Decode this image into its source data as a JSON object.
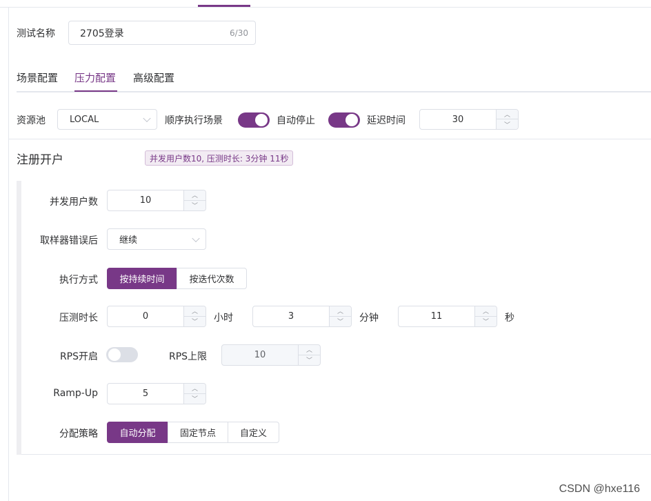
{
  "test": {
    "name_label": "测试名称",
    "name_value": "2705登录",
    "name_count": "6/30"
  },
  "tabs": [
    {
      "label": "场景配置",
      "active": false
    },
    {
      "label": "压力配置",
      "active": true
    },
    {
      "label": "高级配置",
      "active": false
    }
  ],
  "config_row": {
    "resource_pool_label": "资源池",
    "resource_pool_value": "LOCAL",
    "sequential_label": "顺序执行场景",
    "sequential_on": true,
    "auto_stop_label": "自动停止",
    "auto_stop_on": true,
    "delay_label": "延迟时间",
    "delay_value": "30"
  },
  "scenario": {
    "title": "注册开户",
    "summary": "并发用户数10, 压测时长: 3分钟 11秒"
  },
  "form": {
    "concurrent_users_label": "并发用户数",
    "concurrent_users_value": "10",
    "sampler_error_label": "取样器错误后",
    "sampler_error_value": "继续",
    "exec_mode_label": "执行方式",
    "exec_modes": [
      "按持续时间",
      "按迭代次数"
    ],
    "exec_mode_selected": 0,
    "duration_label": "压测时长",
    "hours_value": "0",
    "hours_unit": "小时",
    "minutes_value": "3",
    "minutes_unit": "分钟",
    "seconds_value": "11",
    "seconds_unit": "秒",
    "rps_enabled_label": "RPS开启",
    "rps_enabled": false,
    "rps_limit_label": "RPS上限",
    "rps_limit_value": "10",
    "rampup_label": "Ramp-Up",
    "rampup_value": "5",
    "strategy_label": "分配策略",
    "strategies": [
      "自动分配",
      "固定节点",
      "自定义"
    ],
    "strategy_selected": 0
  },
  "watermark": "CSDN @hxe116",
  "colors": {
    "accent": "#783887",
    "border": "#dcdfe6",
    "tag_bg": "#f2ebf3"
  }
}
